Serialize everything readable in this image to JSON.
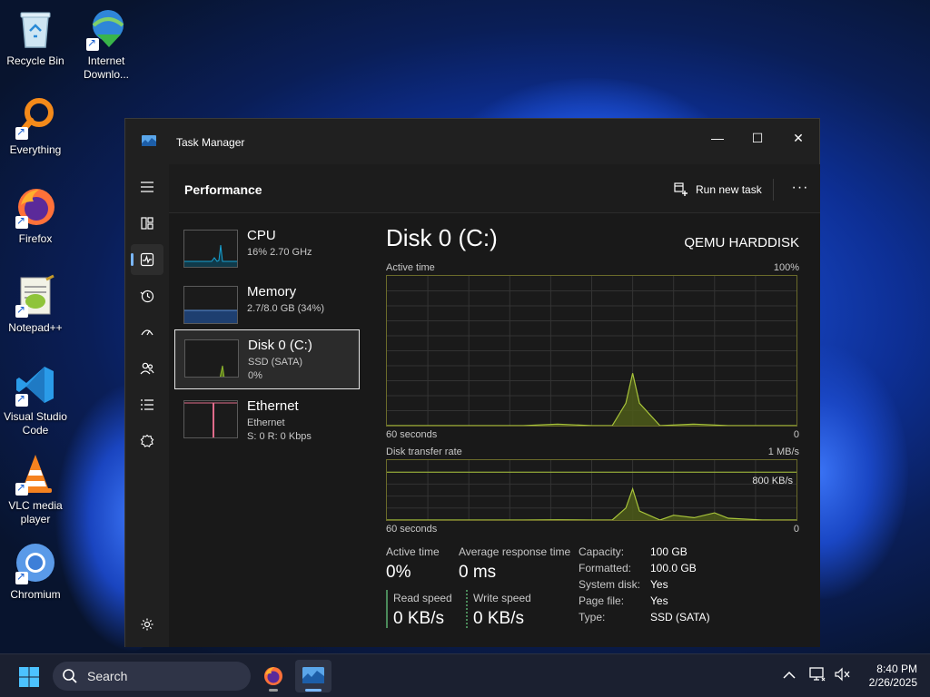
{
  "desktop": {
    "icons": [
      {
        "label": "Recycle Bin",
        "icon": "recycle-bin-icon"
      },
      {
        "label": "Internet Downlo...",
        "icon": "internet-download-manager-icon"
      },
      {
        "label": "Everything",
        "icon": "everything-search-icon"
      },
      {
        "label": "Firefox",
        "icon": "firefox-icon"
      },
      {
        "label": "Notepad++",
        "icon": "notepad-plus-plus-icon"
      },
      {
        "label": "Visual Studio Code",
        "icon": "vscode-icon"
      },
      {
        "label": "VLC media player",
        "icon": "vlc-icon"
      },
      {
        "label": "Chromium",
        "icon": "chromium-icon"
      }
    ]
  },
  "window": {
    "title": "Task Manager",
    "controls": {
      "minimize": "—",
      "maximize": "☐",
      "close": "✕"
    }
  },
  "header": {
    "page_title": "Performance",
    "run_new_task": "Run new task",
    "more": "···"
  },
  "nav": {
    "items": [
      "hamburger-menu-icon",
      "processes-icon",
      "performance-icon",
      "app-history-icon",
      "startup-apps-icon",
      "users-icon",
      "details-icon",
      "services-icon",
      "settings-icon"
    ],
    "active": "performance-icon"
  },
  "sidebar": {
    "items": [
      {
        "name": "CPU",
        "sub": "16% 2.70 GHz",
        "sub2": "",
        "color": "#17a3d4"
      },
      {
        "name": "Memory",
        "sub": "2.7/8.0 GB (34%)",
        "sub2": "",
        "color": "#5b8fd6"
      },
      {
        "name": "Disk 0 (C:)",
        "sub": "SSD (SATA)",
        "sub2": "0%",
        "color": "#8fb82e"
      },
      {
        "name": "Ethernet",
        "sub": "Ethernet",
        "sub2": "S: 0 R: 0 Kbps",
        "color": "#e06b8a"
      }
    ],
    "selected": 2
  },
  "disk": {
    "title": "Disk 0 (C:)",
    "model": "QEMU HARDDISK",
    "active_time_label": "Active time",
    "active_time_max": "100%",
    "active_time_xlabel": "60 seconds",
    "active_time_min": "0",
    "transfer_label": "Disk transfer rate",
    "transfer_max": "1 MB/s",
    "transfer_ref": "800 KB/s",
    "transfer_xlabel": "60 seconds",
    "transfer_min": "0",
    "stats": {
      "active_time_label": "Active time",
      "active_time": "0%",
      "avg_response_label": "Average response time",
      "avg_response": "0 ms",
      "read_speed_label": "Read speed",
      "read_speed": "0 KB/s",
      "write_speed_label": "Write speed",
      "write_speed": "0 KB/s"
    },
    "properties": [
      {
        "name": "Capacity:",
        "value": "100 GB"
      },
      {
        "name": "Formatted:",
        "value": "100.0 GB"
      },
      {
        "name": "System disk:",
        "value": "Yes"
      },
      {
        "name": "Page file:",
        "value": "Yes"
      },
      {
        "name": "Type:",
        "value": "SSD (SATA)"
      }
    ],
    "accent": "#a8c43a",
    "read_color": "#4a8a5a",
    "write_color": "#4a8a5a"
  },
  "chart_data": [
    {
      "type": "area",
      "title": "Active time",
      "xlabel": "60 seconds",
      "ylim": [
        0,
        100
      ],
      "x": [
        0,
        10,
        20,
        25,
        30,
        33,
        35,
        36,
        37,
        40,
        45,
        50,
        55,
        58,
        60
      ],
      "values": [
        0,
        0,
        0,
        1,
        0,
        0,
        15,
        35,
        15,
        0,
        1,
        0,
        0,
        0,
        0
      ]
    },
    {
      "type": "area",
      "title": "Disk transfer rate",
      "xlabel": "60 seconds",
      "ylim": [
        0,
        1000
      ],
      "x": [
        0,
        10,
        20,
        25,
        30,
        33,
        35,
        36,
        37,
        40,
        42,
        45,
        48,
        50,
        55,
        60
      ],
      "values": [
        0,
        0,
        0,
        5,
        0,
        0,
        200,
        520,
        150,
        0,
        80,
        40,
        120,
        30,
        0,
        0
      ],
      "reference_line": 800
    }
  ],
  "taskbar": {
    "search_placeholder": "Search",
    "apps": [
      "start-icon",
      "firefox-icon",
      "task-manager-icon"
    ],
    "tray": [
      "chevron-up-icon",
      "network-icon",
      "volume-muted-icon"
    ],
    "time": "8:40 PM",
    "date": "2/26/2025"
  }
}
